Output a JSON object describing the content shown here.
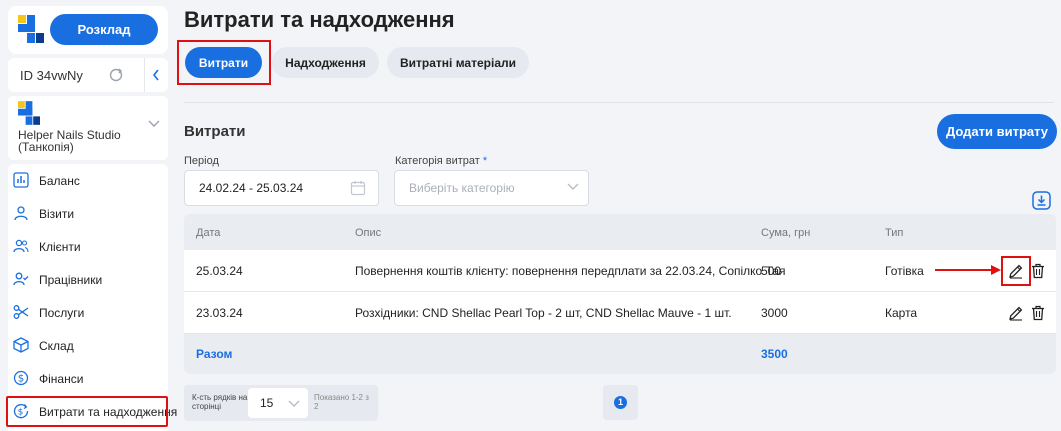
{
  "sidebar": {
    "schedule_button": "Розклад",
    "account_id": "ID 34vwNy",
    "studio_name": "Helper Nails Studio (Танкопія)",
    "items": [
      {
        "label": "Баланс",
        "icon": "chart-icon"
      },
      {
        "label": "Візити",
        "icon": "user-icon"
      },
      {
        "label": "Клієнти",
        "icon": "users-icon"
      },
      {
        "label": "Працівники",
        "icon": "user-check-icon"
      },
      {
        "label": "Послуги",
        "icon": "scissors-icon"
      },
      {
        "label": "Склад",
        "icon": "box-icon"
      },
      {
        "label": "Фінанси",
        "icon": "dollar-icon"
      },
      {
        "label": "Витрати та надходження",
        "icon": "dollar-refresh-icon"
      }
    ]
  },
  "main": {
    "title": "Витрати та надходження",
    "tabs": [
      "Витрати",
      "Надходження",
      "Витратні матеріали"
    ],
    "section_title": "Витрати",
    "add_button": "Додати витрату",
    "period_label": "Період",
    "period_value": "24.02.24 - 25.03.24",
    "category_label": "Категорія витрат",
    "category_required": "*",
    "category_placeholder": "Виберіть категорію"
  },
  "table": {
    "headers": [
      "Дата",
      "Опис",
      "Сума, грн",
      "Тип"
    ],
    "rows": [
      {
        "date": "25.03.24",
        "description": "Повернення коштів клієнту: повернення передплати за 22.03.24, Сопілко Тая",
        "amount": "500",
        "type": "Готівка"
      },
      {
        "date": "23.03.24",
        "description": "Розхідники: CND Shellac Pearl Top - 2 шт, CND Shellac Mauve - 1 шт.",
        "amount": "3000",
        "type": "Карта"
      }
    ],
    "total_label": "Разом",
    "total_value": "3500"
  },
  "pagination": {
    "rows_label": "К-сть рядків на сторінці",
    "rows_value": "15",
    "shown": "Показано 1-2 з 2",
    "page": "1"
  },
  "colors": {
    "accent": "#1a6fe0",
    "highlight": "#e01010"
  }
}
